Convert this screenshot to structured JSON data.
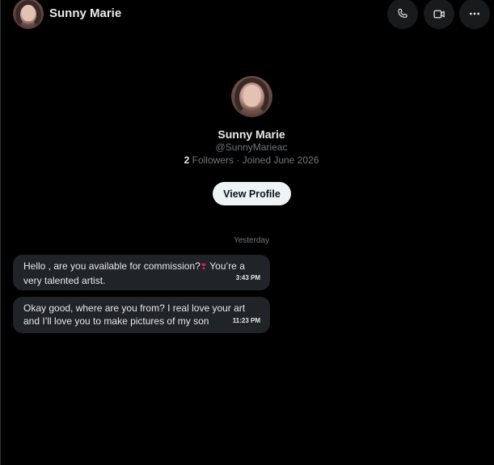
{
  "header": {
    "name": "Sunny Marie",
    "avatar_icon": "avatar-photo",
    "actions": [
      {
        "icon": "phone-icon",
        "label": "Call"
      },
      {
        "icon": "video-icon",
        "label": "Video call"
      },
      {
        "icon": "more-icon",
        "label": "More"
      }
    ]
  },
  "profile": {
    "name": "Sunny Marie",
    "handle": "@SunnyMarieac",
    "followers_count": "2",
    "followers_label": " Followers · Joined June 2026",
    "view_profile_label": "View Profile"
  },
  "conversation": {
    "date_separator": "Yesterday",
    "messages": [
      {
        "text_before": "Hello , are you available for commission?",
        "emoji": "❣",
        "text_after": " You’re a very talented artist.",
        "time": "3:43 PM"
      },
      {
        "text": "Okay good, where are you from? I real love your art and I’ll love you to make pictures of my son",
        "time": "11:23 PM"
      }
    ]
  },
  "colors": {
    "background": "#000000",
    "bubble": "#202327",
    "muted_text": "#71767b",
    "primary_text": "#e7e9ea",
    "button_bg": "#eff3f4"
  }
}
